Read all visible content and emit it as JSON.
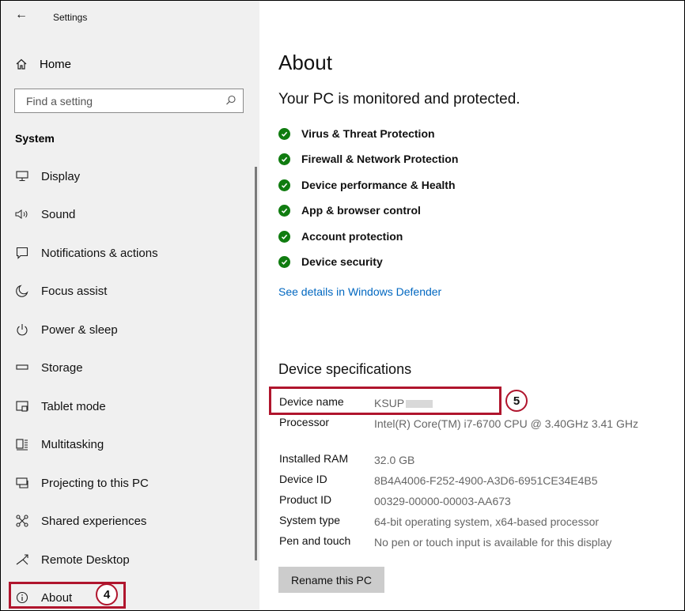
{
  "window": {
    "title": "Settings",
    "back_glyph": "←"
  },
  "sidebar": {
    "home_label": "Home",
    "search_placeholder": "Find a setting",
    "section_title": "System",
    "items": [
      {
        "label": "Display",
        "icon": "display-icon"
      },
      {
        "label": "Sound",
        "icon": "sound-icon"
      },
      {
        "label": "Notifications & actions",
        "icon": "notifications-icon"
      },
      {
        "label": "Focus assist",
        "icon": "focus-assist-icon"
      },
      {
        "label": "Power & sleep",
        "icon": "power-icon"
      },
      {
        "label": "Storage",
        "icon": "storage-icon"
      },
      {
        "label": "Tablet mode",
        "icon": "tablet-mode-icon"
      },
      {
        "label": "Multitasking",
        "icon": "multitasking-icon"
      },
      {
        "label": "Projecting to this PC",
        "icon": "projecting-icon"
      },
      {
        "label": "Shared experiences",
        "icon": "shared-experiences-icon"
      },
      {
        "label": "Remote Desktop",
        "icon": "remote-desktop-icon"
      },
      {
        "label": "About",
        "icon": "info-icon"
      }
    ]
  },
  "main": {
    "title": "About",
    "monitor_status": "Your PC is monitored and protected.",
    "protections": [
      "Virus & Threat Protection",
      "Firewall & Network Protection",
      "Device performance & Health",
      "App & browser control",
      "Account protection",
      "Device security"
    ],
    "defender_link": "See details in Windows Defender",
    "specs_title": "Device specifications",
    "specs": [
      {
        "key": "Device name",
        "value": "KSUP"
      },
      {
        "key": "Processor",
        "value": "Intel(R) Core(TM) i7-6700 CPU @ 3.40GHz   3.41 GHz"
      },
      {
        "key": "Installed RAM",
        "value": "32.0 GB"
      },
      {
        "key": "Device ID",
        "value": "8B4A4006-F252-4900-A3D6-6951CE34E4B5"
      },
      {
        "key": "Product ID",
        "value": "00329-00000-00003-AA673"
      },
      {
        "key": "System type",
        "value": "64-bit operating system, x64-based processor"
      },
      {
        "key": "Pen and touch",
        "value": "No pen or touch input is available for this display"
      }
    ],
    "rename_button": "Rename this PC"
  },
  "callouts": {
    "about_step": "4",
    "device_name_step": "5"
  },
  "colors": {
    "highlight": "#b0152d",
    "check_green": "#107c10",
    "link_blue": "#0067c0",
    "sidebar_bg": "#f0f0f0"
  }
}
